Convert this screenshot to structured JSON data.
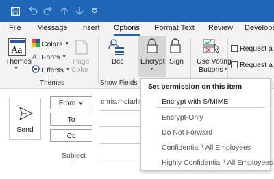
{
  "colors": {
    "title_bar": "#1f66b7",
    "ribbon_bg": "#f3f3f3",
    "active_tab_underline": "#1f66b7"
  },
  "quick_access": [
    "save-icon",
    "undo-icon",
    "redo-icon",
    "up-arrow-icon",
    "down-arrow-icon",
    "customize-icon"
  ],
  "tabs": [
    "File",
    "Message",
    "Insert",
    "Options",
    "Format Text",
    "Review",
    "Developer"
  ],
  "active_tab": "Options",
  "ribbon": {
    "themes_group": {
      "themes_label": "Themes",
      "colors_label": "Colors",
      "fonts_label": "Fonts",
      "effects_label": "Effects",
      "page_color_line1": "Page",
      "page_color_line2": "Color",
      "group_label": "Themes"
    },
    "show_fields_group": {
      "bcc_label": "Bcc",
      "group_label": "Show Fields"
    },
    "encrypt_label": "Encrypt",
    "sign_label": "Sign",
    "voting_line1": "Use Voting",
    "voting_line2": "Buttons",
    "request_delivery": "Request a D",
    "request_read": "Request a R"
  },
  "compose": {
    "send_label": "Send",
    "from_label": "From",
    "from_value": "chris.mcfarling",
    "to_label": "To",
    "cc_label": "Cc",
    "subject_label": "Subject"
  },
  "encrypt_menu": {
    "title": "Set permission on this item",
    "items": [
      "Encrypt with S/MIME",
      "Encrypt-Only",
      "Do Not Forward",
      "Confidential \\ All Employees",
      "Highly Confidential \\ All Employees"
    ]
  }
}
